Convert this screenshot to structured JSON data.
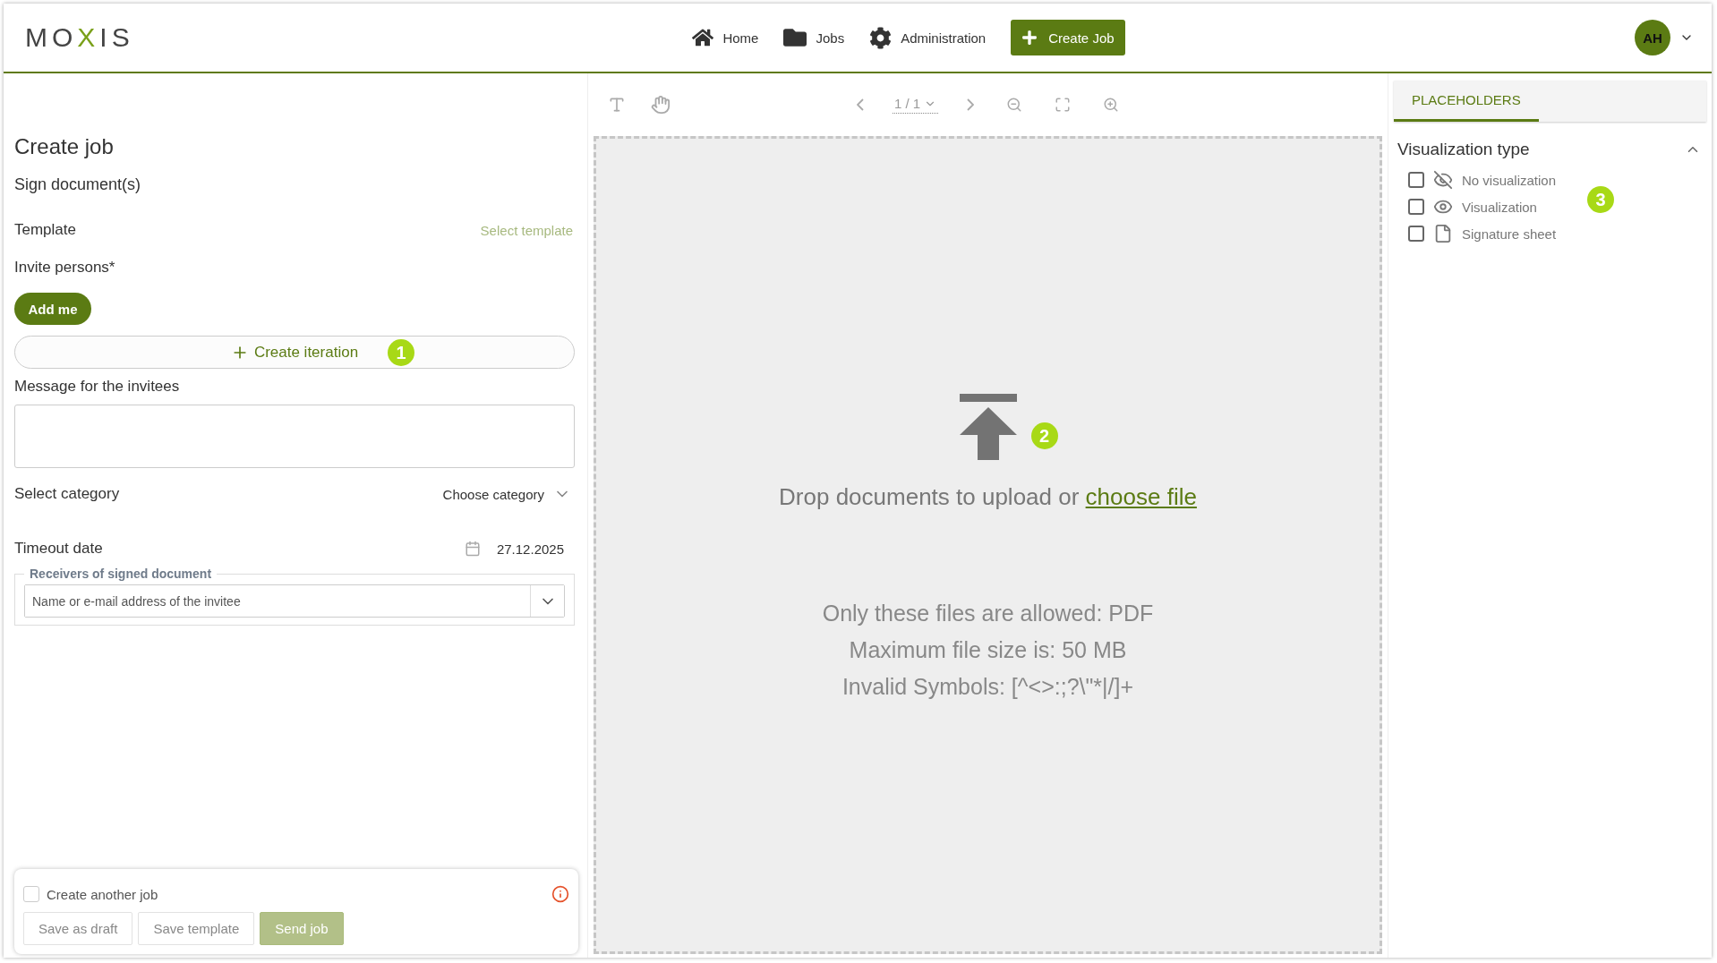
{
  "header": {
    "logo": "MOXIS",
    "nav": [
      {
        "label": "Home",
        "kind": "home"
      },
      {
        "label": "Jobs",
        "kind": "folder"
      },
      {
        "label": "Administration",
        "kind": "gear"
      }
    ],
    "create_button": "Create Job",
    "avatar": "AH"
  },
  "form": {
    "title": "Create job",
    "subtitle": "Sign document(s)",
    "template_label": "Template",
    "template_link": "Select template",
    "invite_label": "Invite persons*",
    "add_me": "Add me",
    "create_iteration": "Create iteration",
    "callout": "1",
    "message_label": "Message for the invitees",
    "category_label": "Select category",
    "category_value": "Choose category",
    "timeout_label": "Timeout date",
    "timeout_value": "27.12.2025",
    "receivers_legend": "Receivers of signed document",
    "receivers_placeholder": "Name or e-mail address of the invitee"
  },
  "footer": {
    "create_another": {
      "label": "Create another job",
      "checked": false
    },
    "buttons": [
      {
        "label": "Save as draft",
        "kind": "secondary",
        "disabled": false
      },
      {
        "label": "Save template",
        "kind": "secondary",
        "disabled": false
      },
      {
        "label": "Send job",
        "kind": "primary",
        "disabled": true
      }
    ]
  },
  "viewer": {
    "page": "1 / 1",
    "drop_text": "Drop documents to upload or",
    "choose_link": "choose file",
    "callout": "2",
    "rules": [
      "Only these files are allowed: PDF",
      "Maximum file size is: 50 MB",
      "Invalid Symbols: [^<>:;?\\\"*|/]+"
    ]
  },
  "placeholders": {
    "tabs": [
      {
        "label": "PLACEHOLDERS",
        "selected": true
      }
    ],
    "section_title": "Visualization type",
    "expanded": true,
    "callout": "3",
    "items": [
      {
        "label": "No visualization",
        "kind": "hidden",
        "checked": false
      },
      {
        "label": "Visualization",
        "kind": "visible",
        "checked": false
      },
      {
        "label": "Signature sheet",
        "kind": "sheet",
        "checked": false
      }
    ]
  }
}
